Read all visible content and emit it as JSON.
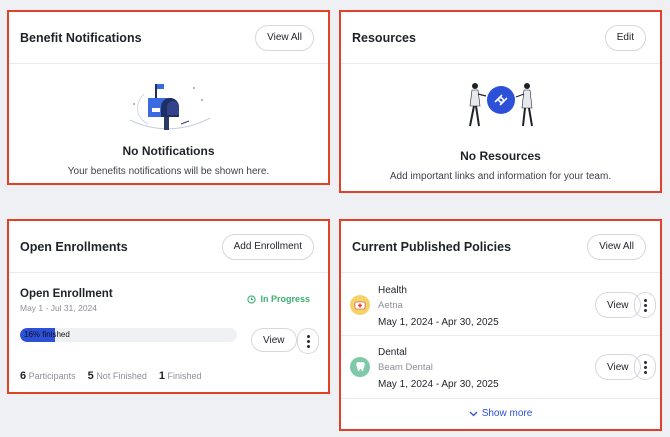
{
  "benefit": {
    "title": "Benefit Notifications",
    "view_all": "View All",
    "empty_title": "No Notifications",
    "empty_text": "Your benefits notifications will be shown here."
  },
  "resources": {
    "title": "Resources",
    "edit": "Edit",
    "empty_title": "No Resources",
    "empty_text": "Add important links and information for your team."
  },
  "enrollments": {
    "title": "Open Enrollments",
    "add": "Add Enrollment",
    "item_title": "Open Enrollment",
    "dates": "May 1 - Jul 31, 2024",
    "status": "In Progress",
    "progress_label": "16% finished",
    "progress_fraction": 0.16,
    "view": "View",
    "stats": [
      {
        "count": "6",
        "label": "Participants"
      },
      {
        "count": "5",
        "label": "Not Finished"
      },
      {
        "count": "1",
        "label": "Finished"
      }
    ]
  },
  "policies": {
    "title": "Current Published Policies",
    "view_all": "View All",
    "items": [
      {
        "name": "Health",
        "carrier": "Aetna",
        "dates": "May 1, 2024 - Apr 30, 2025",
        "view": "View",
        "icon": "health-kit-icon"
      },
      {
        "name": "Dental",
        "carrier": "Beam Dental",
        "dates": "May 1, 2024 - Apr 30, 2025",
        "view": "View",
        "icon": "tooth-icon"
      }
    ],
    "show_more": "Show more"
  },
  "colors": {
    "accent": "#2c50d8",
    "border_highlight": "#e3402a",
    "status_green": "#3bb273"
  }
}
